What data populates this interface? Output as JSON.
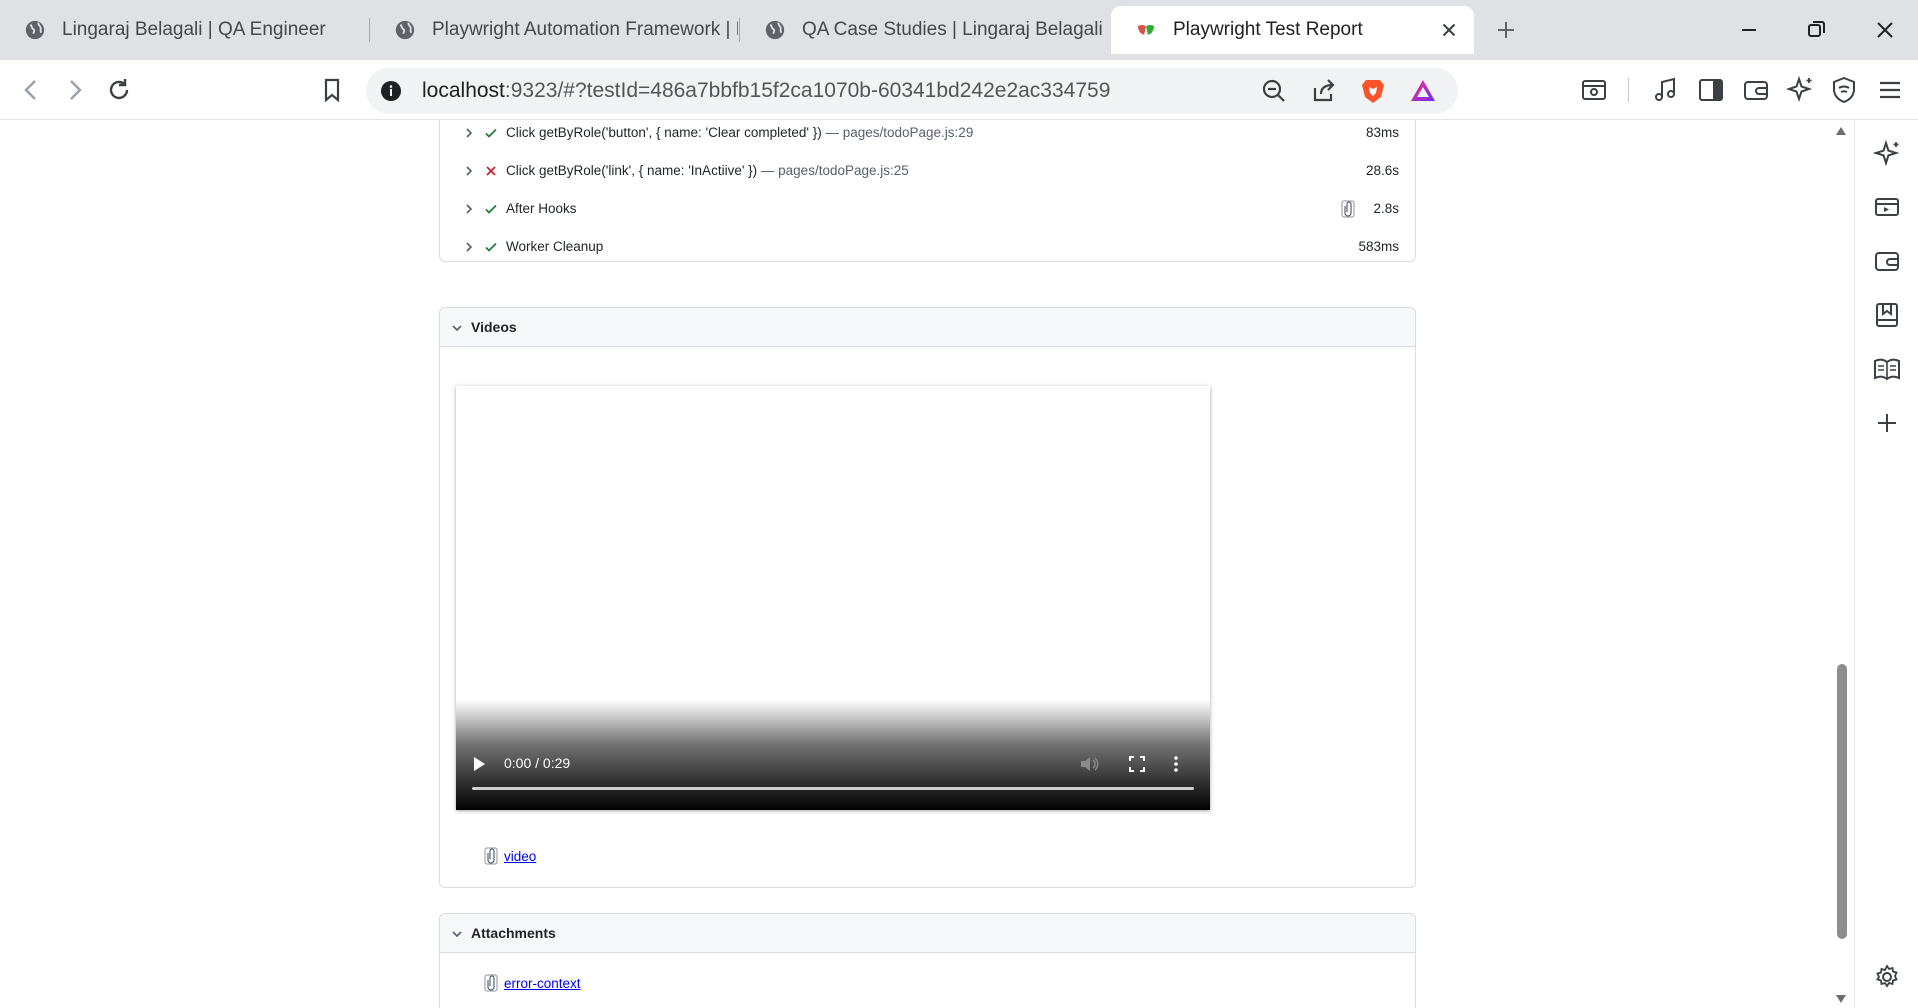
{
  "tabs": [
    {
      "title": "Lingaraj Belagali | QA Engineer",
      "icon": "globe-icon"
    },
    {
      "title": "Playwright Automation Framework | L",
      "icon": "globe-icon"
    },
    {
      "title": "QA Case Studies | Lingaraj Belagali",
      "icon": "globe-icon"
    },
    {
      "title": "Playwright Test Report",
      "icon": "playwright-icon",
      "active": true
    }
  ],
  "address_bar": {
    "host": "localhost",
    "path": ":9323/#?testId=486a7bbfb15f2ca1070b-60341bd242e2ac334759"
  },
  "steps": [
    {
      "title": "Click getByRole('button', { name: 'Clear completed' })",
      "location": " — pages/todoPage.js:29",
      "duration": "83ms",
      "status": "passed"
    },
    {
      "title": "Click getByRole('link', { name: 'InActiive' })",
      "location": " — pages/todoPage.js:25",
      "duration": "28.6s",
      "status": "failed"
    },
    {
      "title": "After Hooks",
      "location": "",
      "duration": "2.8s",
      "status": "passed",
      "has_attachment": true
    },
    {
      "title": "Worker Cleanup",
      "location": "",
      "duration": "583ms",
      "status": "passed"
    }
  ],
  "videos": {
    "title": "Videos",
    "player": {
      "time": "0:00 / 0:29",
      "progress": 0
    },
    "link": "video"
  },
  "attachments": {
    "title": "Attachments",
    "items": [
      "error-context"
    ]
  },
  "colors": {
    "passed": "#1a7f37",
    "failed": "#cf222e",
    "link": "#0000ee",
    "brave_orange": "#fb542b"
  }
}
